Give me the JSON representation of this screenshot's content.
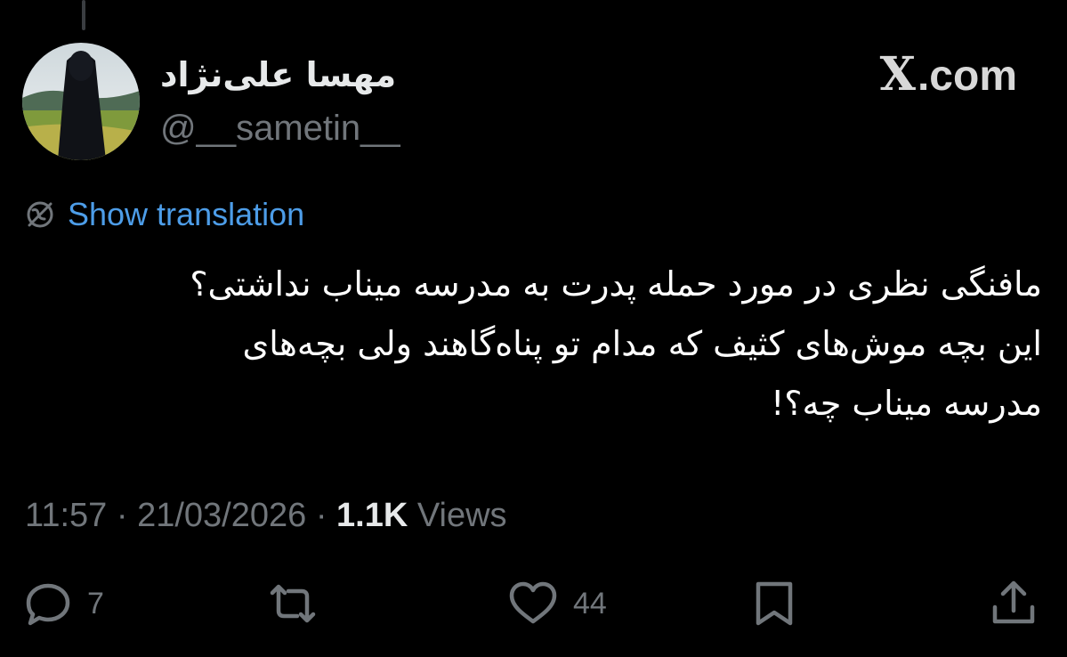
{
  "post": {
    "display_name": "مهسا علی‌نژاد",
    "handle": "@__sametin__",
    "translate_label": "Show translation",
    "text": "مافنگی نظری در مورد حمله پدرت به مدرسه میناب نداشتی؟\nاین بچه موش‌های کثیف که مدام تو پناه‌گاهند ولی بچه‌های\nمدرسه میناب چه؟!",
    "time": "11:57",
    "date": "21/03/2026",
    "views_count": "1.1K",
    "views_label": "Views"
  },
  "brand": {
    "logo": "X",
    "text": ".com"
  },
  "actions": {
    "reply_count": "7",
    "like_count": "44"
  },
  "icons": {
    "reply": "reply-icon",
    "retweet": "retweet-icon",
    "like": "heart-icon",
    "bookmark": "bookmark-icon",
    "share": "share-icon",
    "translate": "globe-icon"
  },
  "colors": {
    "background": "#000000",
    "text": "#e7e9ea",
    "muted": "#71767b",
    "link": "#4d9de8"
  }
}
